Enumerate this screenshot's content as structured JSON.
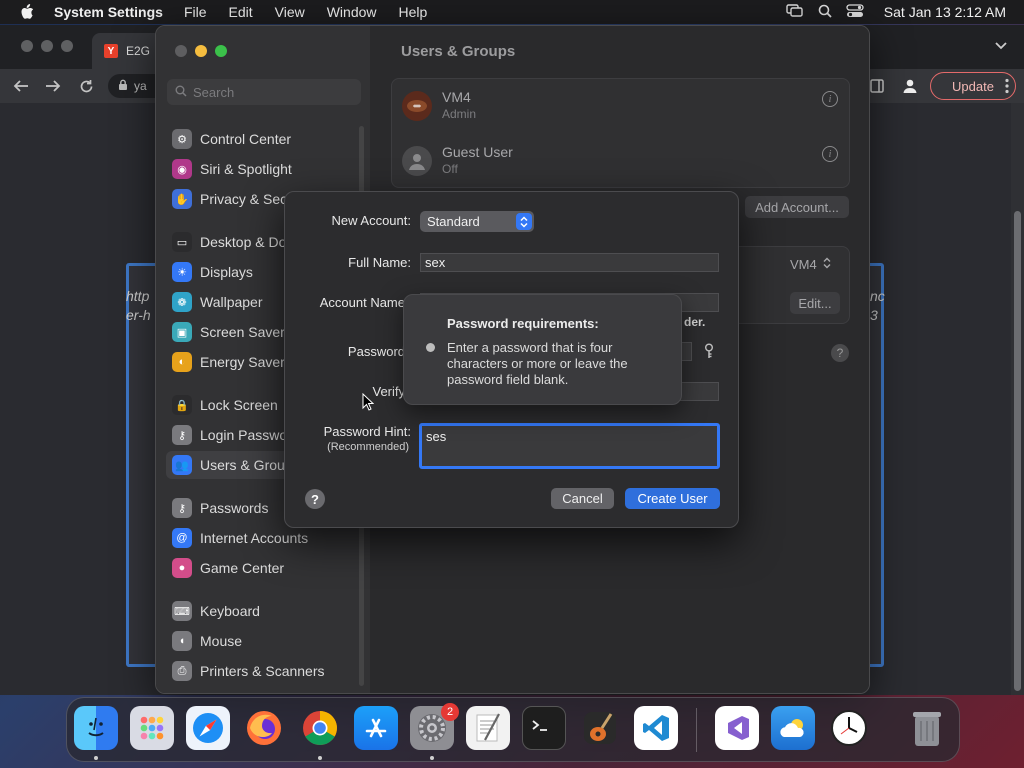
{
  "menubar": {
    "app_name": "System Settings",
    "menus": [
      "File",
      "Edit",
      "View",
      "Window",
      "Help"
    ],
    "clock": "Sat Jan 13  2:12 AM"
  },
  "browser": {
    "tab_title": "E2G",
    "tab_favicon": "Y",
    "omnibox_text": "ya",
    "update_label": "Update",
    "side_text_left": [
      "http",
      "er-h"
    ],
    "side_text_right": [
      "nc",
      "3"
    ]
  },
  "settings": {
    "search_placeholder": "Search",
    "sidebar": [
      {
        "label": "Control Center",
        "icon": "control-center-icon",
        "color": "#6b6b6f"
      },
      {
        "label": "Siri & Spotlight",
        "icon": "siri-icon",
        "color": "#b0388a"
      },
      {
        "label": "Privacy & Security",
        "icon": "hand-icon",
        "color": "#3f6fd8"
      },
      {
        "label": "Desktop & Dock",
        "icon": "dock-icon",
        "color": "#2b2b2d"
      },
      {
        "label": "Displays",
        "icon": "sun-icon",
        "color": "#3478f6"
      },
      {
        "label": "Wallpaper",
        "icon": "wallpaper-icon",
        "color": "#2fa3c8"
      },
      {
        "label": "Screen Saver",
        "icon": "screensaver-icon",
        "color": "#3aa9b8"
      },
      {
        "label": "Energy Saver",
        "icon": "bulb-icon",
        "color": "#e7a21b"
      },
      {
        "label": "Lock Screen",
        "icon": "lock-icon",
        "color": "#2b2b2d"
      },
      {
        "label": "Login Password",
        "icon": "key-icon",
        "color": "#7a7a7e"
      },
      {
        "label": "Users & Groups",
        "icon": "users-icon",
        "color": "#3478f6"
      },
      {
        "label": "Passwords",
        "icon": "key-icon",
        "color": "#7a7a7e"
      },
      {
        "label": "Internet Accounts",
        "icon": "at-icon",
        "color": "#3478f6"
      },
      {
        "label": "Game Center",
        "icon": "game-center-icon",
        "color": "#d34d8a"
      },
      {
        "label": "Keyboard",
        "icon": "keyboard-icon",
        "color": "#7a7a7e"
      },
      {
        "label": "Mouse",
        "icon": "mouse-icon",
        "color": "#7a7a7e"
      },
      {
        "label": "Printers & Scanners",
        "icon": "printer-icon",
        "color": "#7a7a7e"
      }
    ],
    "page_title": "Users & Groups",
    "users": [
      {
        "name": "VM4",
        "status": "Admin"
      },
      {
        "name": "Guest User",
        "status": "Off"
      }
    ],
    "add_account_label": "Add Account...",
    "login_user": "VM4",
    "edit_label": "Edit...",
    "partial_text": "der."
  },
  "sheet": {
    "new_account_label": "New Account:",
    "account_type": "Standard",
    "full_name_label": "Full Name:",
    "full_name_value": "sex",
    "account_name_label": "Account Name",
    "password_label": "Password",
    "verify_label": "Verify",
    "hint_label": "Password Hint:",
    "hint_sublabel": "(Recommended)",
    "hint_value": "ses",
    "cancel_label": "Cancel",
    "create_label": "Create User",
    "help_label": "?"
  },
  "tooltip": {
    "title": "Password requirements:",
    "text": "Enter a password that is four characters or more or leave the password field blank."
  },
  "dock": {
    "settings_badge": "2"
  },
  "colors": {
    "accent": "#3478f6",
    "create_button": "#2f6fdc",
    "update_border": "#e46a6a"
  }
}
